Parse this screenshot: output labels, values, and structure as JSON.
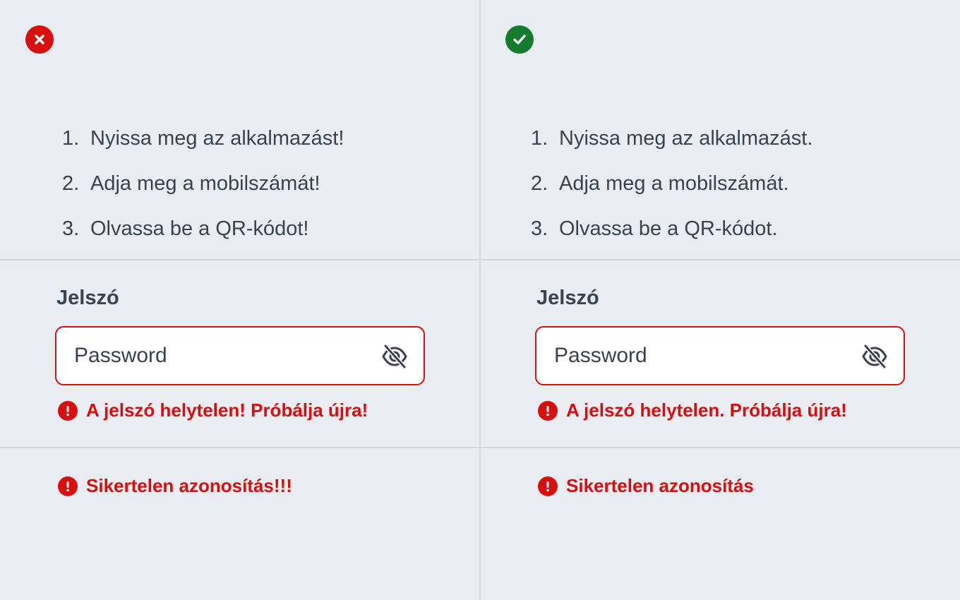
{
  "colors": {
    "background": "#e9ecf0",
    "error": "#d60f0f",
    "success": "#157c2e",
    "text": "#3b4150",
    "divider": "#d4d8de"
  },
  "left": {
    "badge_icon": "x-icon",
    "steps": [
      {
        "num": "1.",
        "text": "Nyissa meg az alkalmazást!"
      },
      {
        "num": "2.",
        "text": "Adja meg a mobilszámát!"
      },
      {
        "num": "3.",
        "text": "Olvassa be a QR-kódot!"
      }
    ],
    "field_label": "Jelszó",
    "password_placeholder": "Password",
    "field_error": "A jelszó helytelen! Próbálja újra!",
    "auth_error": "Sikertelen azonosítás!!!"
  },
  "right": {
    "badge_icon": "checkmark-icon",
    "steps": [
      {
        "num": "1.",
        "text": "Nyissa meg az alkalmazást."
      },
      {
        "num": "2.",
        "text": "Adja meg a mobilszámát."
      },
      {
        "num": "3.",
        "text": "Olvassa be a QR-kódot."
      }
    ],
    "field_label": "Jelszó",
    "password_placeholder": "Password",
    "field_error": "A jelszó helytelen. Próbálja újra!",
    "auth_error": "Sikertelen azonosítás"
  }
}
